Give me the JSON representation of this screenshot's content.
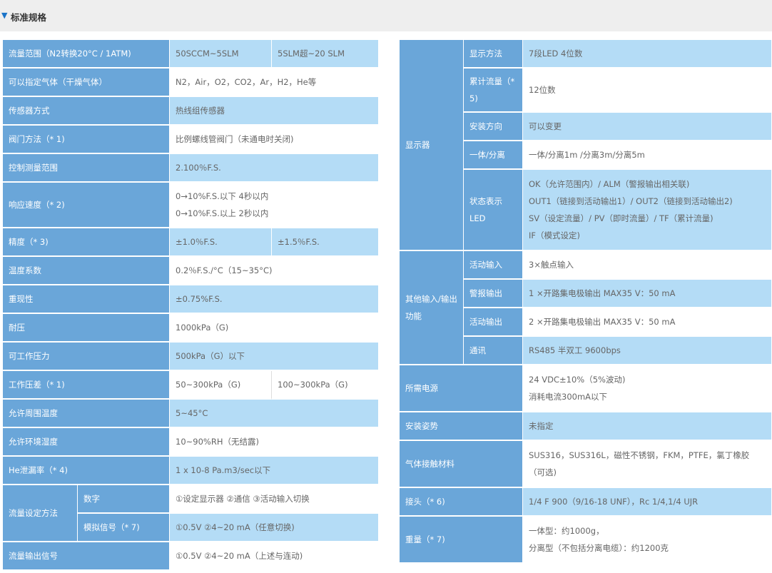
{
  "section_title": "标准规格",
  "left": {
    "flow_range": {
      "label": "流量范围（N2转换20°C / 1ATM)",
      "v1": "50SCCM~5SLM",
      "v2": "5SLM超~20 SLM"
    },
    "gases": {
      "label": "可以指定气体（干燥气体）",
      "value": "N2，Air，O2，CO2，Ar，H2，He等"
    },
    "sensor": {
      "label": "传感器方式",
      "value": "热线组传感器"
    },
    "valve": {
      "label": "阀门方法（* 1)",
      "value": "比例螺线管阀门（未通电时关闭)"
    },
    "control_range": {
      "label": "控制测量范围",
      "value": "2.100％F.S."
    },
    "response": {
      "label": "响应速度（* 2)",
      "line1": "0→10%F.S.以下 4秒以内",
      "line2": "0→10%F.S.以上 2秒以内"
    },
    "accuracy": {
      "label": "精度（* 3)",
      "v1": "±1.0％F.S.",
      "v2": "±1.5％F.S."
    },
    "temp_coef": {
      "label": "温度系数",
      "value": "0.2％F.S./°C（15~35°C)"
    },
    "repeat": {
      "label": "重现性",
      "value": "±0.75%F.S."
    },
    "pressure_res": {
      "label": "耐压",
      "value": "1000kPa（G)"
    },
    "work_pressure": {
      "label": "可工作压力",
      "value": "500kPa（G）以下"
    },
    "diff_pressure": {
      "label": "工作压差（* 1)",
      "v1": "50~300kPa（G)",
      "v2": "100~300kPa（G)"
    },
    "ambient_temp": {
      "label": "允许周围温度",
      "value": "5~45°C"
    },
    "humidity": {
      "label": "允许环境湿度",
      "value": "10~90%RH（无结露)"
    },
    "leak": {
      "label": "He泄漏率（* 4)",
      "value": "1 x 10-8 Pa.m3/sec以下"
    },
    "setting": {
      "label": "流量设定方法",
      "digital_label": "数字",
      "digital_value": "①设定显示器 ②通信 ③活动输入切换",
      "analog_label": "模拟信号（* 7)",
      "analog_value": "①0.5V ②4~20 mA（任意切换)"
    },
    "output": {
      "label": "流量输出信号",
      "value": "①0.5V ②4~20 mA（上述与连动)"
    }
  },
  "right": {
    "display": {
      "label": "显示器",
      "method": {
        "label": "显示方法",
        "value": "7段LED 4位数"
      },
      "cumulative": {
        "label": "累计流量（* 5)",
        "value": "12位数"
      },
      "install_dir": {
        "label": "安装方向",
        "value": "可以变更"
      },
      "separation": {
        "label": "一体/分离",
        "value": "一体/分离1m /分离3m/分离5m"
      },
      "status_led": {
        "label": "状态表示LED",
        "line1": "OK（允许范围内）/ ALM（警报输出相关联)",
        "line2": "OUT1（链接到活动输出1）/ OUT2（链接到活动输出2)",
        "line3": "SV（设定流量）/ PV（即时流量）/ TF（累计流量)",
        "line4": "IF（模式设定)"
      }
    },
    "io": {
      "label": "其他输入/输出功能",
      "active_in": {
        "label": "活动输入",
        "value": "3×触点输入"
      },
      "alarm_out": {
        "label": "警报输出",
        "value": "1 ×开路集电极输出 MAX35 V：50 mA"
      },
      "active_out": {
        "label": "活动输出",
        "value": "2 ×开路集电极输出 MAX35 V：50 mA"
      },
      "comm": {
        "label": "通讯",
        "value": "RS485 半双工 9600bps"
      }
    },
    "power": {
      "label": "所需电源",
      "line1": "24 VDC±10%（5%波动)",
      "line2": "消耗电流300mA以下"
    },
    "posture": {
      "label": "安装姿势",
      "value": "未指定"
    },
    "material": {
      "label": "气体接触材料",
      "value": "SUS316，SUS316L，磁性不锈钢，FKM，PTFE，氯丁橡胶（可选)"
    },
    "joint": {
      "label": "接头（* 6)",
      "value": "1/4 F 900（9/16-18 UNF），Rc 1/4,1/4 UJR"
    },
    "weight": {
      "label": "重量（* 7)",
      "line1": "一体型：约1000g，",
      "line2": "分离型（不包括分离电缆）：约1200克"
    }
  }
}
